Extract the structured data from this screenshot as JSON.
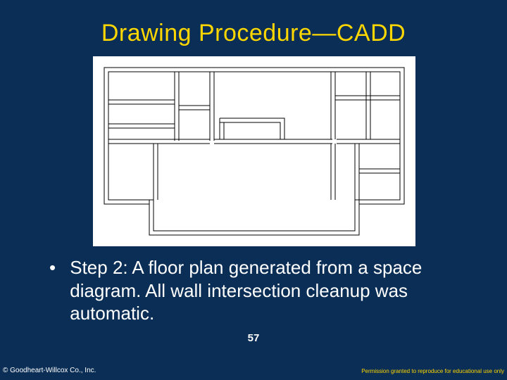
{
  "title": "Drawing Procedure—CADD",
  "bullet": {
    "marker": "•",
    "text": "Step 2: A floor plan generated from a space diagram. All wall intersection cleanup was automatic."
  },
  "page_number": "57",
  "footer": {
    "left": "© Goodheart-Willcox Co., Inc.",
    "right": "Permission granted to reproduce for educational use only"
  },
  "image": {
    "description": "floor-plan-line-drawing"
  }
}
